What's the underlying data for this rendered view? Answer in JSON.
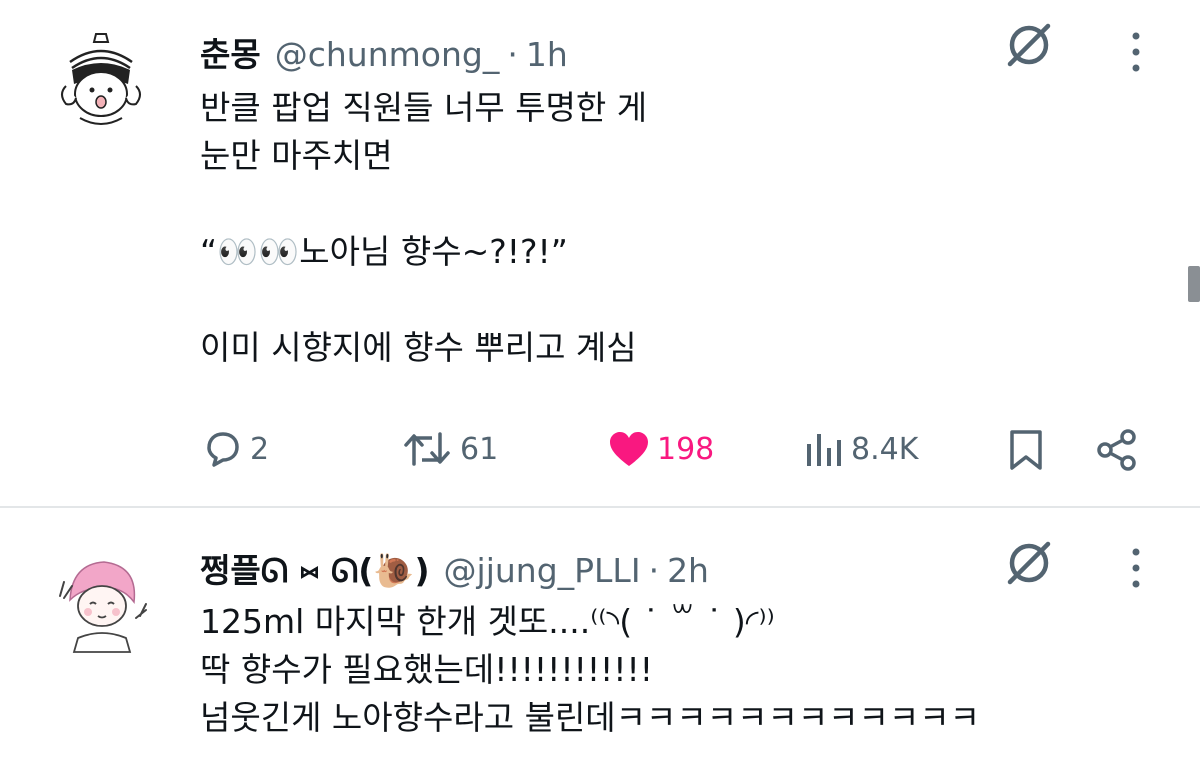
{
  "tweets": [
    {
      "display_name": "춘몽",
      "handle": "@chunmong_",
      "separator": "·",
      "time": "1h",
      "text_lines": [
        "반클 팝업 직원들 너무 투명한 게",
        "눈만 마주치면",
        "",
        "“👀👀노아님 향수~?!?!”",
        "",
        "이미 시향지에 향수 뿌리고 계심"
      ],
      "actions": {
        "replies": "2",
        "reposts": "61",
        "likes": "198",
        "views": "8.4K"
      }
    },
    {
      "display_name": "쩡플ᘏ ⑅ ᘏ(🐌)",
      "handle": "@jjung_PLLI",
      "separator": "·",
      "time": "2h",
      "text_lines": [
        "125ml 마지막 한개 겟또....⁽⁽◝( ˙ ꒳ ˙ )◜⁾⁾",
        "딱 향수가 필요했는데!!!!!!!!!!!!",
        "넘웃긴게 노아향수라고 불린데ㅋㅋㅋㅋㅋㅋㅋㅋㅋㅋㅋㅋ"
      ]
    }
  ],
  "colors": {
    "text": "#0f1419",
    "secondary": "#536471",
    "like": "#f91880",
    "divider": "#e3e6e8"
  },
  "icons": [
    "grok-icon",
    "more-icon",
    "reply-icon",
    "repost-icon",
    "like-icon",
    "views-icon",
    "bookmark-icon",
    "share-icon"
  ]
}
